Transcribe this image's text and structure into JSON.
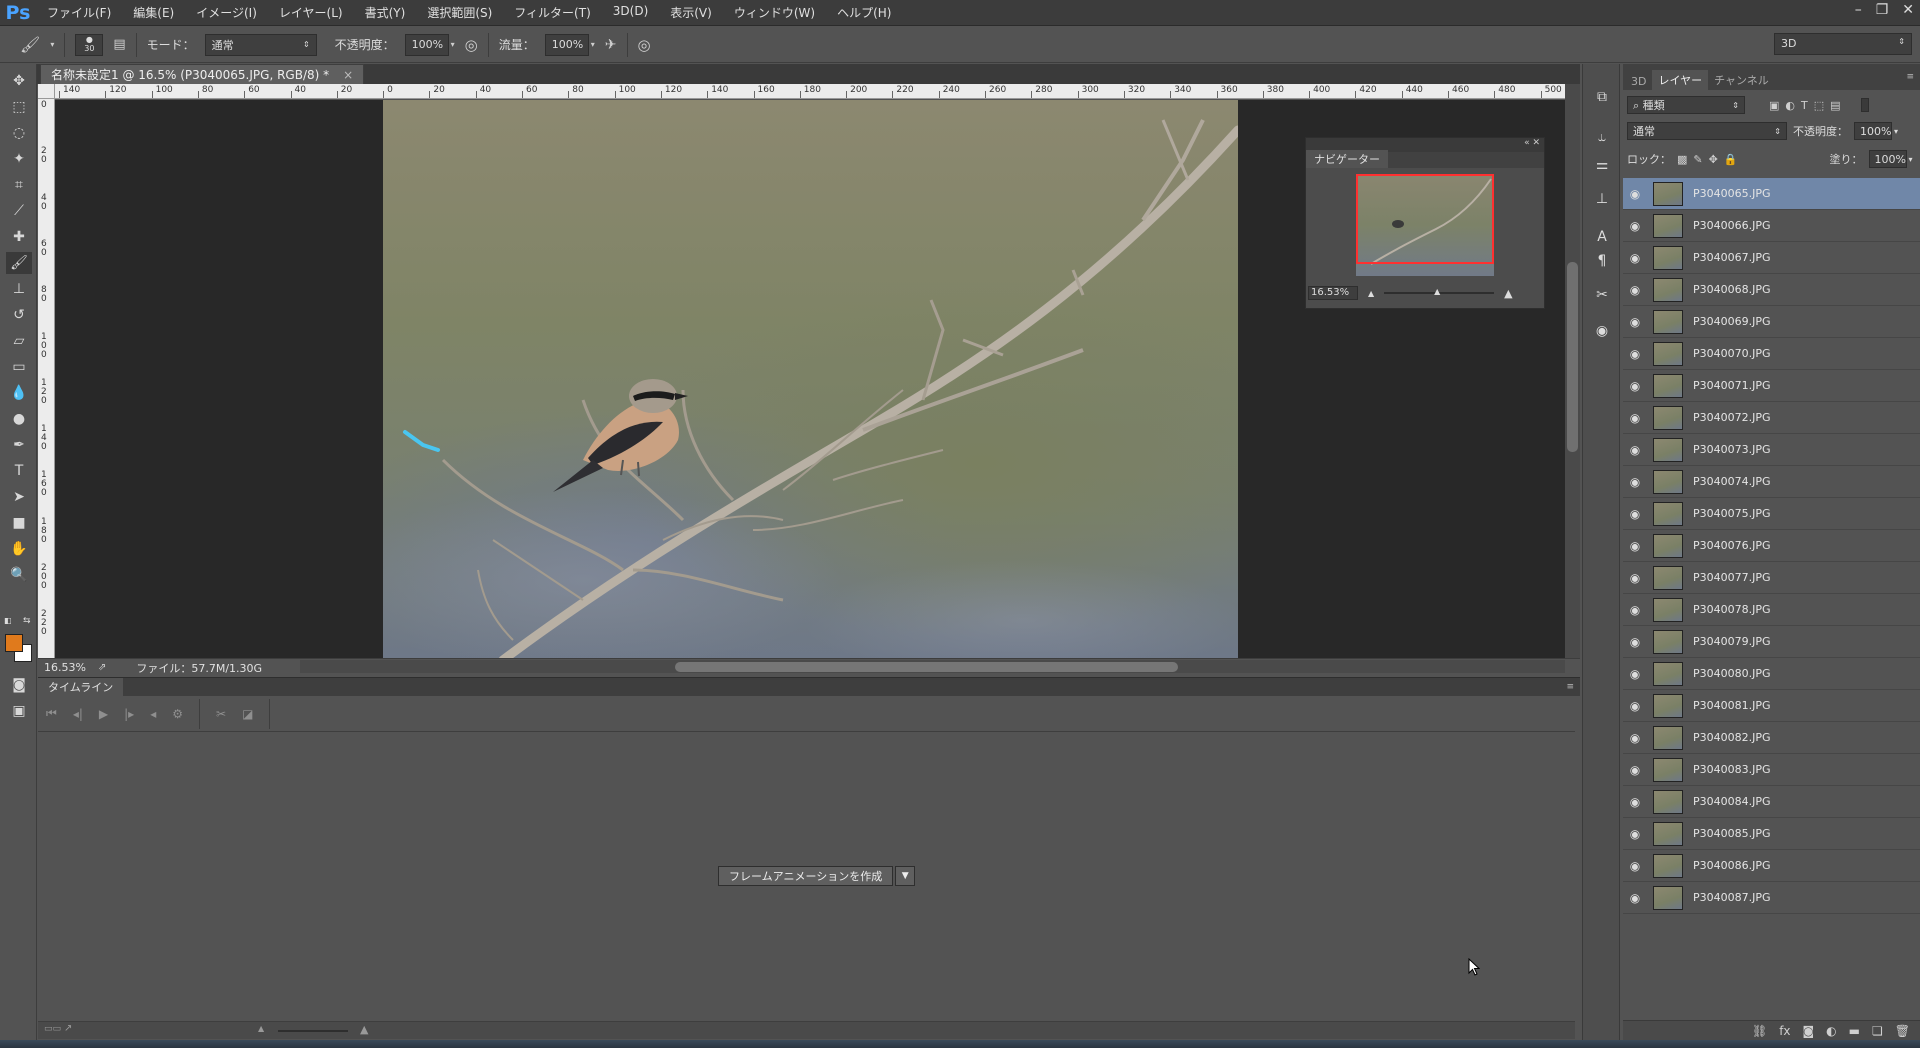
{
  "app": {
    "logo": "Ps",
    "menu": [
      "ファイル(F)",
      "編集(E)",
      "イメージ(I)",
      "レイヤー(L)",
      "書式(Y)",
      "選択範囲(S)",
      "フィルター(T)",
      "3D(D)",
      "表示(V)",
      "ウィンドウ(W)",
      "ヘルプ(H)"
    ],
    "window_controls": [
      "–",
      "❐",
      "✕"
    ]
  },
  "options": {
    "brush_size": "30",
    "mode_label": "モード：",
    "mode_value": "通常",
    "opacity_label": "不透明度：",
    "opacity_value": "100%",
    "flow_label": "流量：",
    "flow_value": "100%",
    "workspace": "3D"
  },
  "document": {
    "tab_title": "名称未設定1 @ 16.5% (P3040065.JPG, RGB/8) *",
    "close": "×",
    "ruler_top": [
      "140",
      "120",
      "100",
      "80",
      "60",
      "40",
      "20",
      "0",
      "20",
      "40",
      "60",
      "80",
      "100",
      "120",
      "140",
      "160",
      "180",
      "200",
      "220",
      "240",
      "260",
      "280",
      "300",
      "320",
      "340",
      "360",
      "380",
      "400",
      "420",
      "440",
      "460",
      "480",
      "500"
    ],
    "ruler_left": [
      "0",
      "20",
      "40",
      "60",
      "80",
      "100",
      "120",
      "140",
      "160",
      "180",
      "200",
      "220"
    ],
    "zoom": "16.53%",
    "file_info": "ファイル：57.7M/1.30G"
  },
  "navigator": {
    "title": "ナビゲーター",
    "zoom": "16.53%"
  },
  "timeline": {
    "title": "タイムライン",
    "create_button": "フレームアニメーションを作成"
  },
  "layers_panel": {
    "tabs": [
      "3D",
      "レイヤー",
      "チャンネル"
    ],
    "active_tab": 1,
    "filter_kind": "種類",
    "blend_mode": "通常",
    "opacity_label": "不透明度：",
    "opacity_value": "100%",
    "lock_label": "ロック：",
    "fill_label": "塗り：",
    "fill_value": "100%",
    "layers": [
      {
        "name": "P3040065.JPG",
        "selected": true
      },
      {
        "name": "P3040066.JPG"
      },
      {
        "name": "P3040067.JPG"
      },
      {
        "name": "P3040068.JPG"
      },
      {
        "name": "P3040069.JPG"
      },
      {
        "name": "P3040070.JPG"
      },
      {
        "name": "P3040071.JPG"
      },
      {
        "name": "P3040072.JPG"
      },
      {
        "name": "P3040073.JPG"
      },
      {
        "name": "P3040074.JPG"
      },
      {
        "name": "P3040075.JPG"
      },
      {
        "name": "P3040076.JPG"
      },
      {
        "name": "P3040077.JPG"
      },
      {
        "name": "P3040078.JPG"
      },
      {
        "name": "P3040079.JPG"
      },
      {
        "name": "P3040080.JPG"
      },
      {
        "name": "P3040081.JPG"
      },
      {
        "name": "P3040082.JPG"
      },
      {
        "name": "P3040083.JPG"
      },
      {
        "name": "P3040084.JPG"
      },
      {
        "name": "P3040085.JPG"
      },
      {
        "name": "P3040086.JPG"
      },
      {
        "name": "P3040087.JPG"
      }
    ]
  },
  "colors": {
    "foreground": "#e07a1c",
    "background": "#ffffff",
    "selection": "#7087a8"
  }
}
